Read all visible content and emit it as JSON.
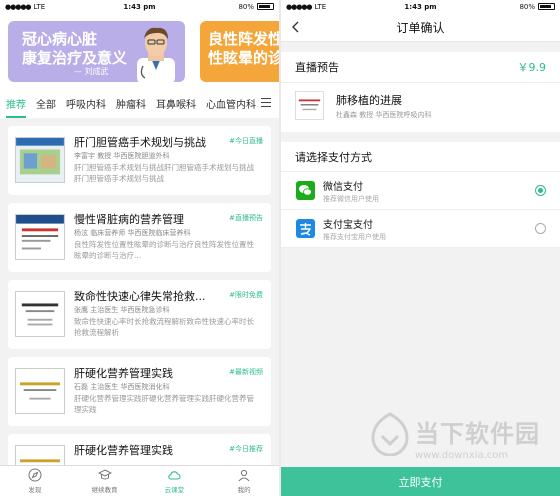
{
  "status_left": {
    "carrier": "LTE",
    "time": "1:43 pm",
    "battery": "80%"
  },
  "status_right": {
    "carrier": "LTE",
    "time": "1:43 pm",
    "battery": "80%"
  },
  "banners": [
    {
      "line1": "冠心病心脏",
      "line2": "康复治疗及意义",
      "author": "— 刘成武"
    },
    {
      "line1": "良性阵发性位",
      "line2": "性眩晕的诊断"
    }
  ],
  "tabs": [
    "推荐",
    "全部",
    "呼吸内科",
    "肿瘤科",
    "耳鼻喉科",
    "心血管内科"
  ],
  "active_tab": "推荐",
  "cards": [
    {
      "title": "肝门胆管癌手术规划与挑战",
      "tag": "#今日直播",
      "meta": "李富宇  教授  华西医院胆道外科",
      "desc": "肝门胆管癌手术规划与挑战肝门胆管癌手术规划与挑战肝门胆管癌手术规划与挑战"
    },
    {
      "title": "慢性肾脏病的营养管理",
      "tag": "#直播预告",
      "meta": "杨泫  临床营养师  华西医院临床营养科",
      "desc": "良性阵发性位置性眩晕的诊断与治疗良性阵发性位置性眩晕的诊断与治疗..."
    },
    {
      "title": "致命性快速心律失常抢救...",
      "tag": "#限时免费",
      "meta": "张鹰  主治医生  华西医院急诊科",
      "desc": "致命性快速心率时长抢救流程解析致命性快速心率时长抢救流程解析"
    },
    {
      "title": "肝硬化营养管理实践",
      "tag": "#最新视频",
      "meta": "石磊  主治医生  华西医院消化科",
      "desc": "肝硬化营养管理实践肝硬化营养管理实践肝硬化营养管理实践"
    },
    {
      "title": "肝硬化营养管理实践",
      "tag": "#今日推荐",
      "meta": "",
      "desc": ""
    }
  ],
  "tabbar": [
    {
      "label": "发现",
      "icon": "compass-icon"
    },
    {
      "label": "继续教育",
      "icon": "graduation-cap-icon"
    },
    {
      "label": "云课堂",
      "icon": "cloud-icon"
    },
    {
      "label": "我的",
      "icon": "user-icon"
    }
  ],
  "active_tabbar": "云课堂",
  "order": {
    "nav_title": "订单确认",
    "section_title": "直播预告",
    "price": "￥9.9",
    "course_title": "肺移植的进展",
    "course_meta": "杜鑫森  教授  华西医院呼吸内科",
    "pay_heading": "请选择支付方式",
    "methods": [
      {
        "name": "微信支付",
        "sub": "推荐微信用户使用",
        "selected": true,
        "icon": "wechat-pay-icon"
      },
      {
        "name": "支付宝支付",
        "sub": "推荐支付宝用户使用",
        "selected": false,
        "icon": "alipay-icon"
      }
    ],
    "pay_button": "立即支付"
  },
  "watermark": {
    "text": "当下软件园",
    "url": "www.downxia.com"
  },
  "colors": {
    "accent": "#2cbd8d",
    "banner1": "#b9aee8",
    "banner2": "#f4a63a",
    "wechat": "#1aad19",
    "alipay": "#1e88e5"
  }
}
